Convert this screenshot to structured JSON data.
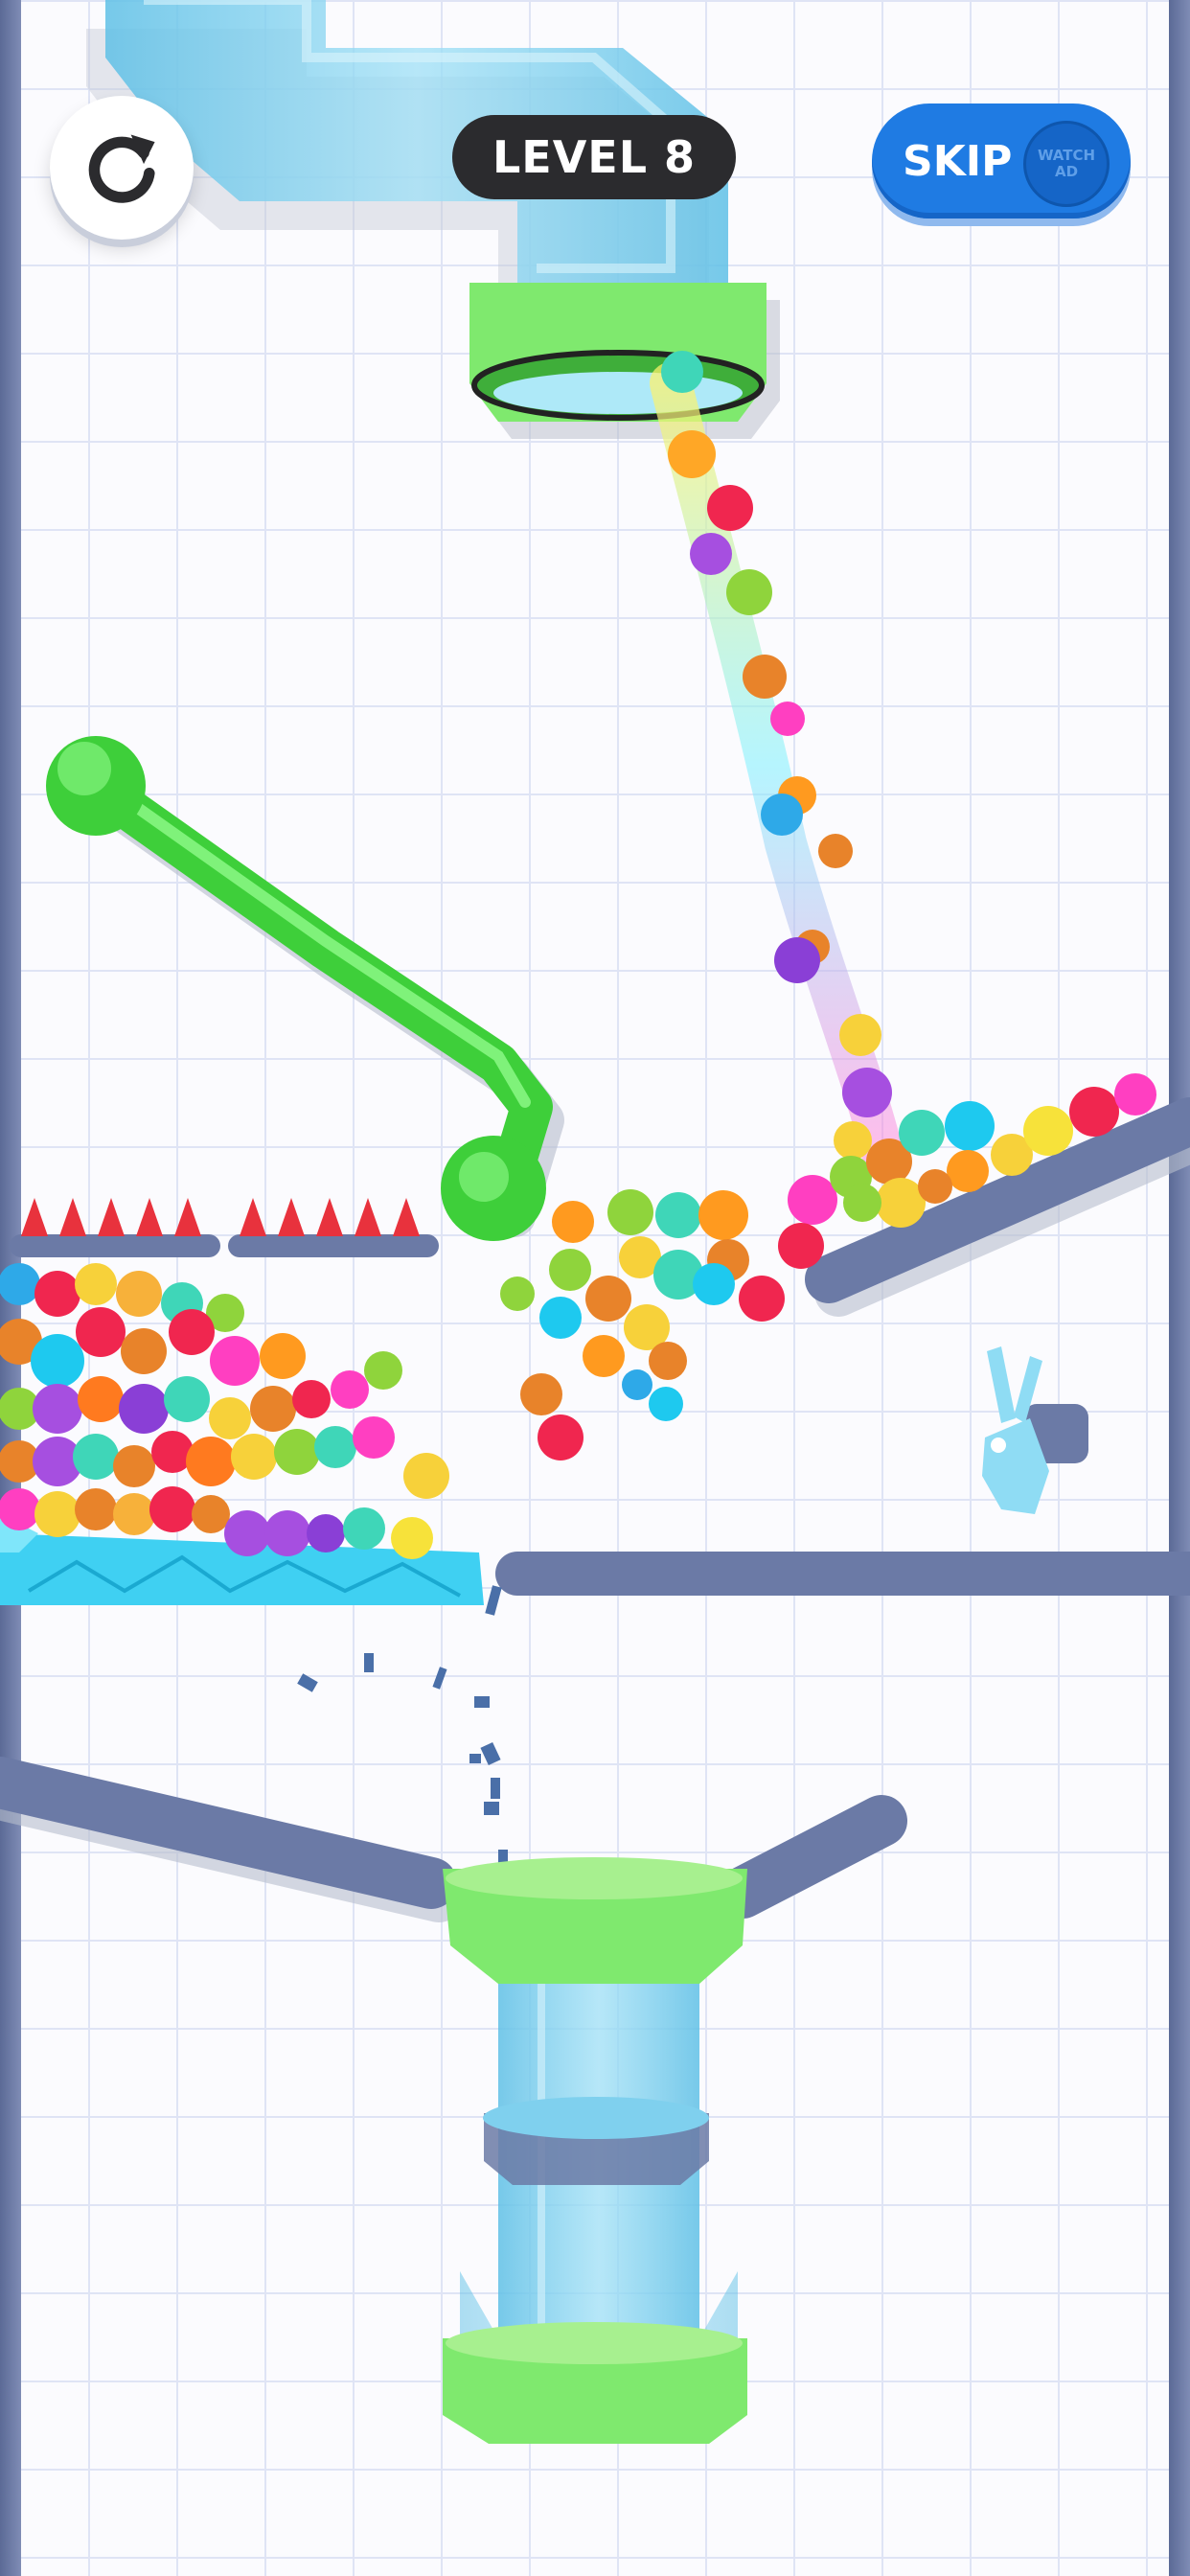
{
  "hud": {
    "level_label": "LEVEL 8",
    "skip_label": "SKIP",
    "watch_ad_line1": "WATCH",
    "watch_ad_line2": "AD"
  },
  "icons": {
    "restart": "restart-icon",
    "skip_ad": "video-ad-icon"
  },
  "colors": {
    "grid_line": "#dfe4f5",
    "wall": "#6b7aa6",
    "pipe_glass": "#7fd0ee",
    "pipe_rim": "#7ded6e",
    "hose": "#47d94b",
    "spike": "#e8323d",
    "ice": "#3fd0f2",
    "skip_button": "#1f7be3",
    "level_pill": "#2b2b2e"
  }
}
